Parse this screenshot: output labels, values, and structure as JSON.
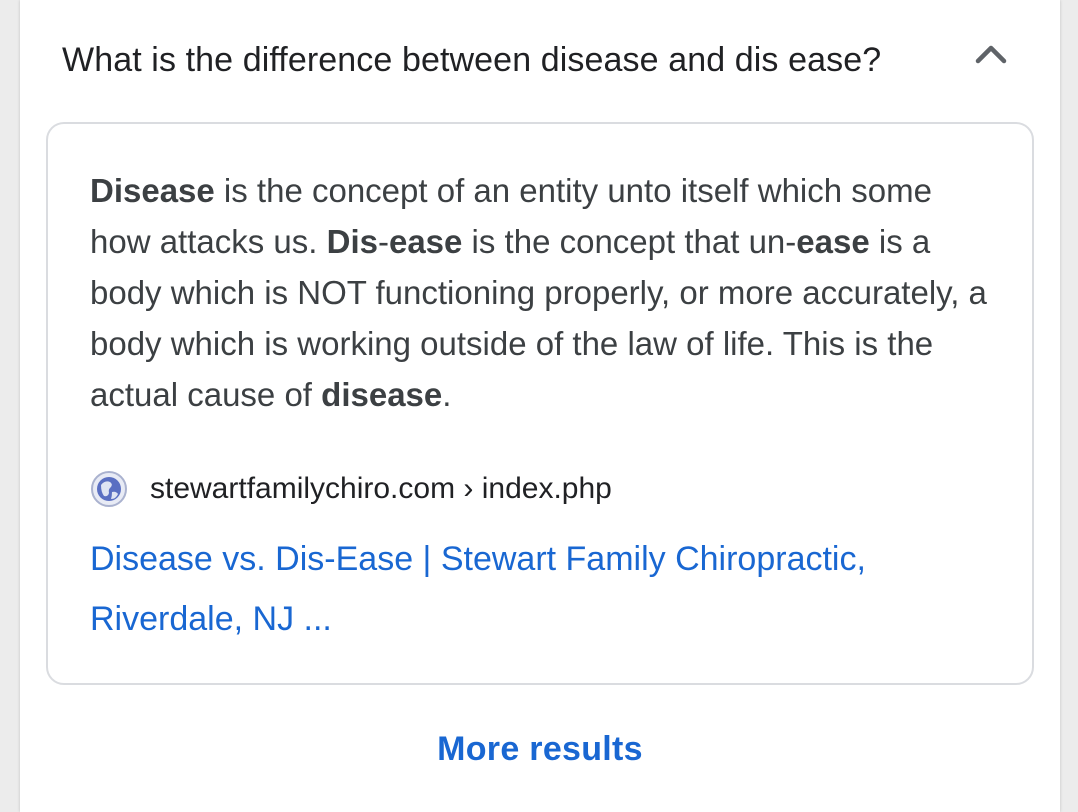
{
  "question": {
    "text": "What is the difference between disease and dis ease?",
    "expanded_icon": "chevron-up-icon"
  },
  "answer": {
    "seg1_bold": "Disease",
    "seg2": " is the concept of an entity unto itself which some how attacks us. ",
    "seg3_bold": "Dis",
    "seg4": "-",
    "seg5_bold": "ease",
    "seg6": " is the concept that un-",
    "seg7_bold": "ease",
    "seg8": " is a body which is NOT functioning properly, or more accurately, a body which is working outside of the law of life. This is the actual cause of ",
    "seg9_bold": "disease",
    "seg10": "."
  },
  "source": {
    "icon": "globe-icon",
    "url": "stewartfamilychiro.com › index.php",
    "title": "Disease vs. Dis-Ease | Stewart Family Chiropractic, Riverdale, NJ ..."
  },
  "footer": {
    "more_results_label": "More results"
  },
  "colors": {
    "link": "#1967d2",
    "text": "#3c4043",
    "border": "#dadce0"
  }
}
